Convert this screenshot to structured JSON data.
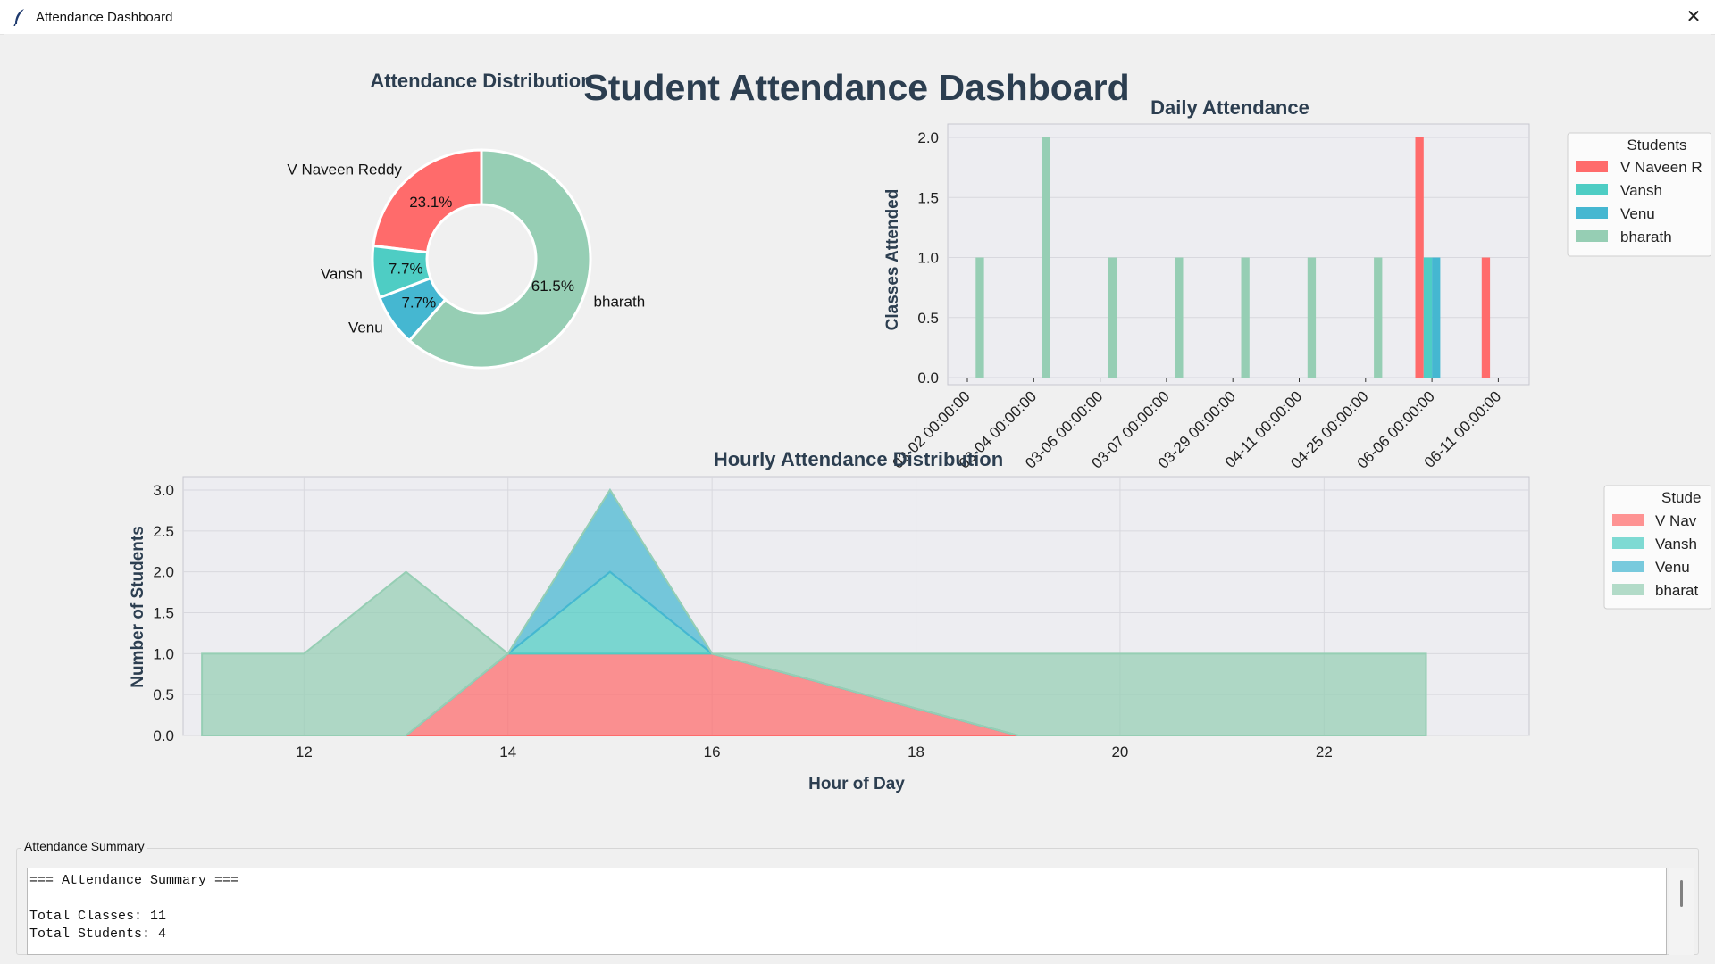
{
  "window": {
    "title": "Attendance Dashboard",
    "close_glyph": "✕"
  },
  "dashboard_title": "Student Attendance Dashboard",
  "colors": {
    "V Naveen Reddy": "#ff6b6b",
    "Vansh": "#4ecdc4",
    "Venu": "#45b7d1",
    "bharath": "#96ceb4",
    "title": "#2c3e50"
  },
  "pie": {
    "title": "Attendance Distribution",
    "labels": [
      "V Naveen Reddy",
      "Vansh",
      "Venu",
      "bharath"
    ],
    "percents": [
      "23.1%",
      "7.7%",
      "7.7%",
      "61.5%"
    ]
  },
  "daily": {
    "title": "Daily Attendance",
    "ylabel": "Classes Attended",
    "yticks": [
      "0.0",
      "0.5",
      "1.0",
      "1.5",
      "2.0"
    ],
    "xticks": [
      "03-02 00:00:00",
      "03-04 00:00:00",
      "03-06 00:00:00",
      "03-07 00:00:00",
      "03-29 00:00:00",
      "04-11 00:00:00",
      "04-25 00:00:00",
      "06-06 00:00:00",
      "06-11 00:00:00"
    ],
    "legend_title": "Students",
    "legend_labels": [
      "V Naveen R",
      "Vansh",
      "Venu",
      "bharath"
    ]
  },
  "hourly": {
    "title": "Hourly Attendance Distribution",
    "xlabel": "Hour of Day",
    "ylabel": "Number of Students",
    "yticks": [
      "0.0",
      "0.5",
      "1.0",
      "1.5",
      "2.0",
      "2.5",
      "3.0"
    ],
    "xticks": [
      "12",
      "14",
      "16",
      "18",
      "20",
      "22"
    ],
    "legend_title": "Stude",
    "legend_labels": [
      "V Nav",
      "Vansh",
      "Venu",
      "bharat"
    ]
  },
  "summary": {
    "label": "Attendance Summary",
    "text": "=== Attendance Summary ===\n\nTotal Classes: 11\nTotal Students: 4"
  },
  "chart_data": [
    {
      "type": "pie",
      "title": "Attendance Distribution",
      "categories": [
        "V Naveen Reddy",
        "Vansh",
        "Venu",
        "bharath"
      ],
      "values": [
        23.1,
        7.7,
        7.7,
        61.5
      ]
    },
    {
      "type": "bar",
      "title": "Daily Attendance",
      "ylabel": "Classes Attended",
      "ylim": [
        0,
        2
      ],
      "categories": [
        "03-02 00:00:00",
        "03-04 00:00:00",
        "03-06 00:00:00",
        "03-07 00:00:00",
        "03-29 00:00:00",
        "04-11 00:00:00",
        "04-25 00:00:00",
        "06-06 00:00:00",
        "06-11 00:00:00"
      ],
      "series": [
        {
          "name": "V Naveen R",
          "values": [
            0,
            0,
            0,
            0,
            0,
            0,
            0,
            2,
            1
          ]
        },
        {
          "name": "Vansh",
          "values": [
            0,
            0,
            0,
            0,
            0,
            0,
            0,
            1,
            0
          ]
        },
        {
          "name": "Venu",
          "values": [
            0,
            0,
            0,
            0,
            0,
            0,
            0,
            1,
            0
          ]
        },
        {
          "name": "bharath",
          "values": [
            1,
            2,
            1,
            1,
            1,
            1,
            1,
            0,
            0
          ]
        }
      ],
      "legend": "right",
      "grid": true
    },
    {
      "type": "area",
      "title": "Hourly Attendance Distribution",
      "xlabel": "Hour of Day",
      "ylabel": "Number of Students",
      "stacked": true,
      "x": [
        11,
        12,
        13,
        14,
        15,
        16,
        17,
        18,
        19,
        20,
        21,
        22,
        23
      ],
      "ylim": [
        0,
        3
      ],
      "series": [
        {
          "name": "V Nav",
          "values": [
            0,
            0,
            0,
            1,
            1,
            1,
            0.67,
            0.33,
            0,
            0,
            0,
            0,
            0
          ]
        },
        {
          "name": "Vansh",
          "values": [
            0,
            0,
            0,
            0,
            1,
            0,
            0,
            0,
            0,
            0,
            0,
            0,
            0
          ]
        },
        {
          "name": "Venu",
          "values": [
            0,
            0,
            0,
            0,
            1,
            0,
            0,
            0,
            0,
            0,
            0,
            0,
            0
          ]
        },
        {
          "name": "bharat",
          "values": [
            1,
            1,
            2,
            0,
            0,
            0,
            0.33,
            0.67,
            1,
            1,
            1,
            1,
            1
          ]
        }
      ],
      "legend": "right",
      "grid": true
    }
  ]
}
